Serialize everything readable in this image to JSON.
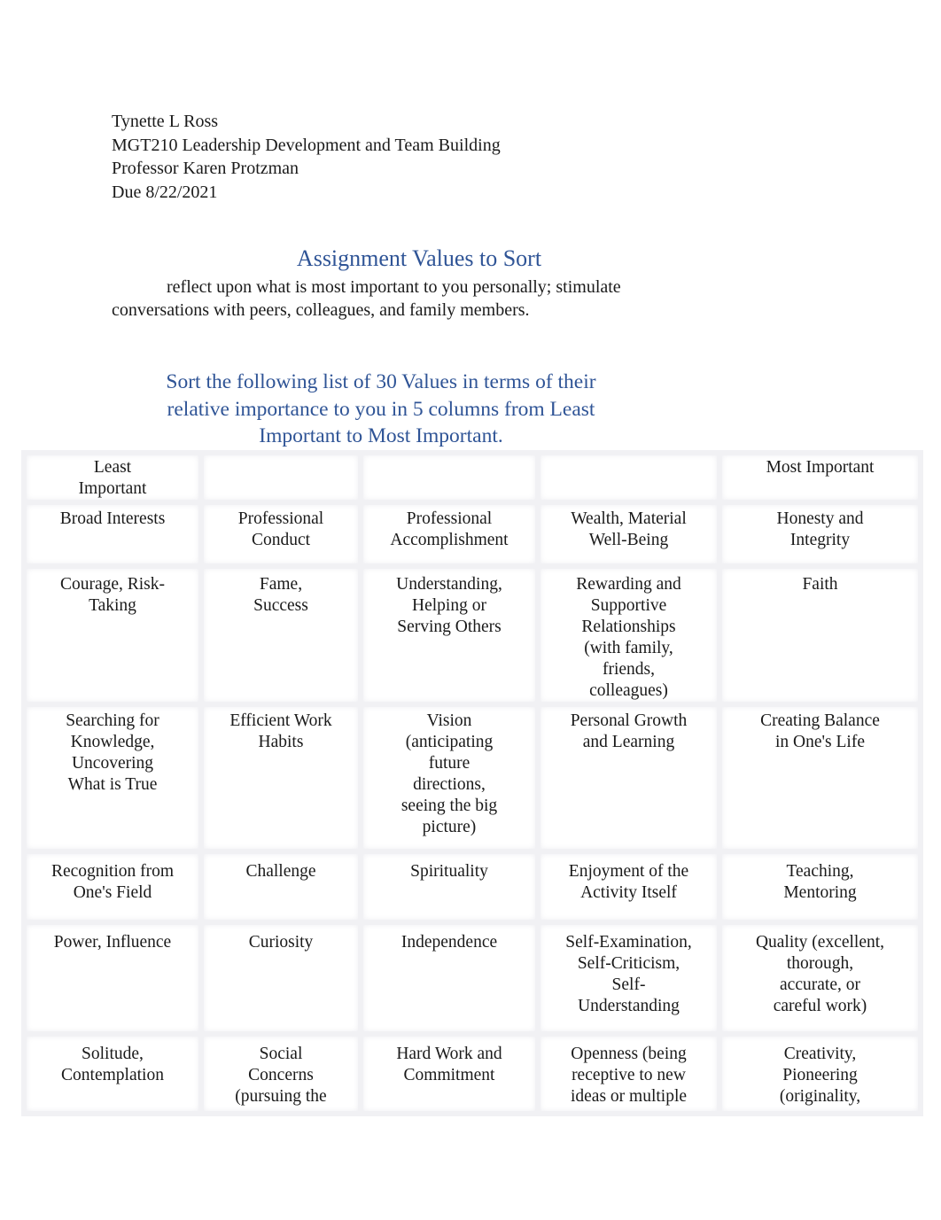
{
  "header": {
    "student_name": "Tynette L Ross",
    "course": "MGT210 Leadership Development and Team Building",
    "professor": "Professor Karen Protzman",
    "due": "Due 8/22/2021"
  },
  "title": "Assignment Values to Sort",
  "intro": {
    "line1": "reflect upon what is most important to you personally; stimulate",
    "line2": "conversations with peers, colleagues, and family members."
  },
  "instructions": "Sort the following list of 30 Values in terms of their relative importance to you in 5 columns from Least Important to Most Important.",
  "colors": {
    "heading_blue": "#2f5496",
    "grid_gray": "#f1f1f4"
  },
  "table": {
    "headers": [
      "Least\nImportant",
      "",
      "",
      "",
      "Most Important"
    ],
    "rows": [
      [
        "Broad Interests",
        "Professional\nConduct",
        "Professional\nAccomplishment",
        "Wealth, Material\nWell-Being",
        "Honesty and\nIntegrity"
      ],
      [
        "Courage, Risk-\nTaking",
        "Fame,\nSuccess",
        "Understanding,\nHelping or\nServing Others",
        "Rewarding and\nSupportive\nRelationships\n(with family,\nfriends,\ncolleagues)",
        "Faith"
      ],
      [
        "Searching for\nKnowledge,\nUncovering\nWhat is True",
        "Efficient Work\nHabits",
        "Vision\n(anticipating\nfuture\ndirections,\nseeing the big\npicture)",
        "Personal Growth\nand Learning",
        "Creating Balance\nin One's Life"
      ],
      [
        "Recognition from\nOne's Field",
        "Challenge",
        "Spirituality",
        "Enjoyment of the\nActivity Itself",
        "Teaching,\nMentoring"
      ],
      [
        "Power, Influence",
        "Curiosity",
        "Independence",
        "Self-Examination,\nSelf-Criticism,\nSelf-\nUnderstanding",
        "Quality (excellent,\nthorough,\naccurate, or\ncareful work)"
      ],
      [
        "Solitude,\nContemplation",
        "Social\nConcerns\n(pursuing the",
        "Hard Work and\nCommitment",
        "Openness (being\nreceptive to new\nideas or multiple",
        "Creativity,\nPioneering\n(originality,"
      ]
    ]
  }
}
